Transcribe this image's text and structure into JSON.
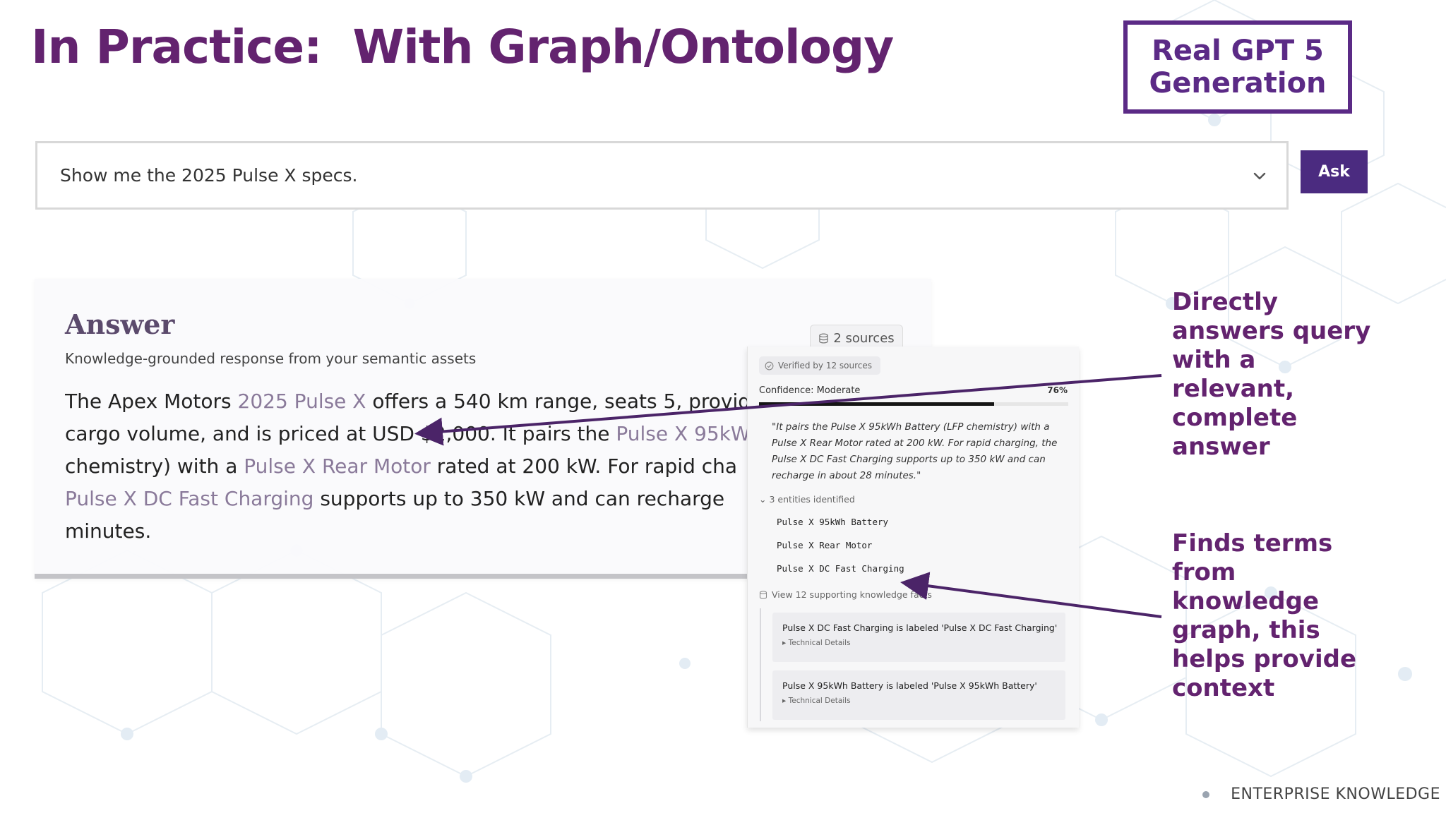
{
  "slide": {
    "title": "In Practice:  With Graph/Ontology",
    "badge_line1": "Real GPT 5",
    "badge_line2": "Generation",
    "footer": "ENTERPRISE KNOWLEDGE"
  },
  "search": {
    "query": "Show me the 2025 Pulse X specs.",
    "ask_label": "Ask",
    "dropdown_icon": "chevron-down-icon"
  },
  "answer": {
    "title": "Answer",
    "subtitle": "Knowledge-grounded response from your semantic assets",
    "sources_label": "2 sources",
    "body_segments": {
      "l1_a": "The Apex Motors ",
      "l1_b": "2025 Pulse X",
      "l1_c": " offers a 540 km range, seats 5, provid",
      "l2_a": "cargo volume, and is priced at USD ",
      "l2_b": "$2,000.",
      "l2_c": "  It pairs the ",
      "l2_d": "Pulse X 95kW",
      "l3_a": "chemistry) with a ",
      "l3_b": "Pulse X Rear Motor",
      "l3_c": " rated at 200 kW. For rapid cha",
      "l4_a": "Pulse X DC Fast Charging",
      "l4_b": " supports up to 350 kW and can recharge",
      "l5_a": "minutes."
    }
  },
  "sources_panel": {
    "verified_label": "Verified by 12 sources",
    "confidence_label": "Confidence: Moderate",
    "confidence_pct": "76%",
    "confidence_value": 0.76,
    "quote": "\"It pairs the Pulse X 95kWh Battery (LFP chemistry) with a Pulse X Rear Motor rated at 200 kW. For rapid charging, the Pulse X DC Fast Charging supports up to 350 kW and can recharge in about 28 minutes.\"",
    "entities_label": "3 entities identified",
    "entities": [
      "Pulse X 95kWh Battery",
      "Pulse X Rear Motor",
      "Pulse X DC Fast Charging"
    ],
    "facts_link": "View 12 supporting knowledge facts",
    "facts": [
      {
        "text": "Pulse X DC Fast Charging is labeled 'Pulse X DC Fast Charging'",
        "detail": "Technical Details"
      },
      {
        "text": "Pulse X 95kWh Battery is labeled 'Pulse X 95kWh Battery'",
        "detail": "Technical Details"
      }
    ]
  },
  "annotations": {
    "top": [
      "Directly",
      "answers query",
      "with a",
      "relevant,",
      "complete",
      "answer"
    ],
    "bottom": [
      "Finds terms",
      "from",
      "knowledge",
      "graph, this",
      "helps provide",
      "context"
    ]
  },
  "colors": {
    "brand_purple": "#63236f",
    "ask_button": "#4b2b80",
    "arrow": "#4b2468",
    "highlight_term": "#8a7a9a"
  }
}
